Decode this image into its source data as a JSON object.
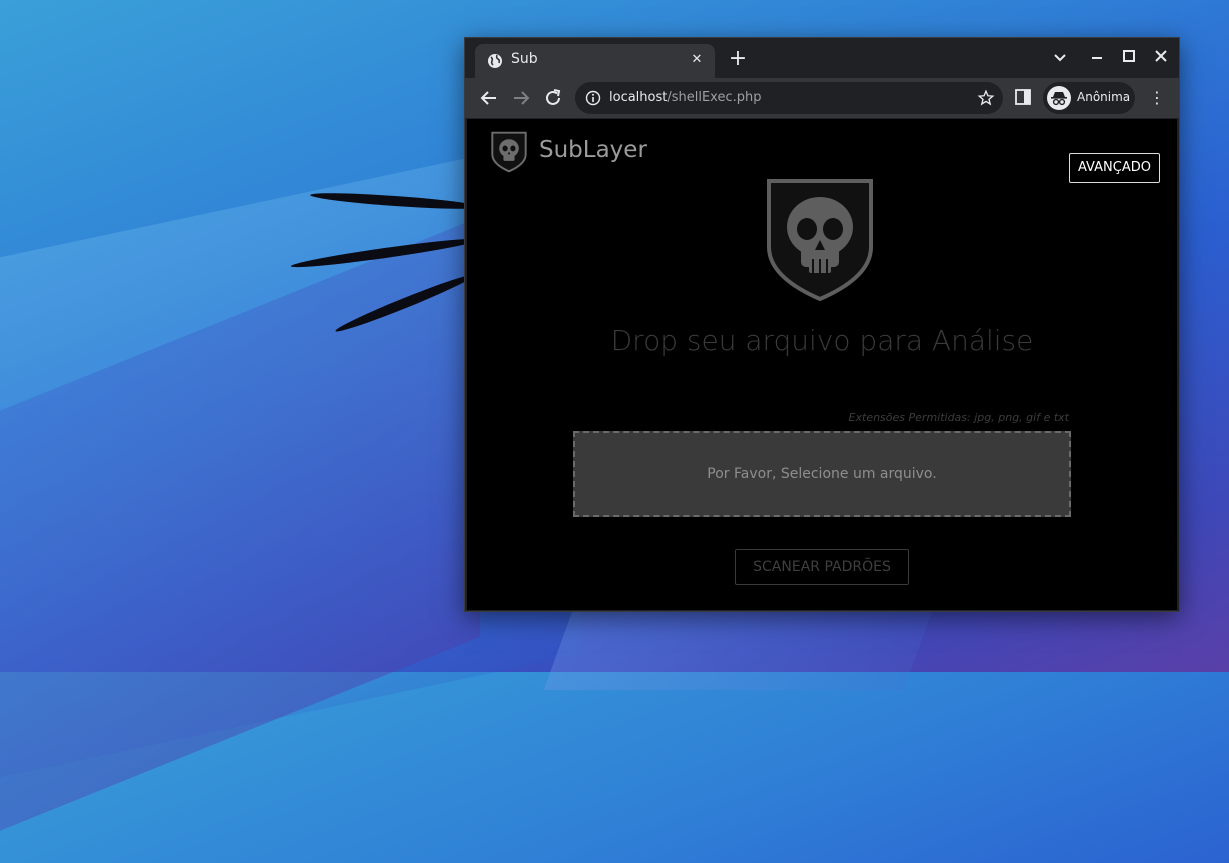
{
  "browser": {
    "tab_title": "Sub",
    "url_host": "localhost",
    "url_path": "/shellExec.php",
    "profile_label": "Anônima"
  },
  "page": {
    "brand": "SubLayer",
    "advanced_button": "AVANÇADO",
    "headline": "Drop seu arquivo para Análise",
    "allowed_extensions": "Extensões Permitidas: jpg, png, gif e txt",
    "dropzone_text": "Por Favor, Selecione um arquivo.",
    "scan_button": "SCANEAR PADRÕES"
  },
  "icons": [
    "globe-icon",
    "close-icon",
    "new-tab-icon",
    "chevron-down-icon",
    "minimize-icon",
    "maximize-icon",
    "window-close-icon",
    "back-icon",
    "forward-icon",
    "reload-icon",
    "info-icon",
    "star-icon",
    "side-panel-icon",
    "incognito-icon",
    "menu-icon",
    "skull-shield-icon"
  ],
  "colors": {
    "page_background": "#000000",
    "chrome_dark": "#202124",
    "chrome_toolbar": "#35363a",
    "dropzone": "#3a3a3a"
  }
}
